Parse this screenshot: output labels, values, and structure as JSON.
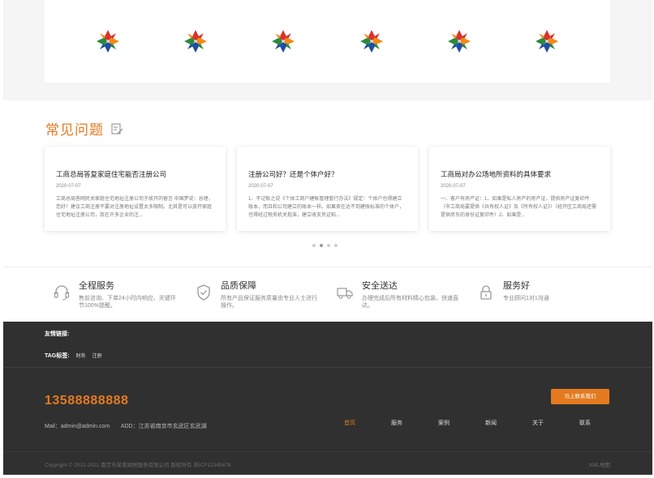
{
  "logos": {
    "count": 6,
    "colors": [
      "#d9342b",
      "#f08a1c",
      "#2b8a3e",
      "#1f4fa0"
    ]
  },
  "faq": {
    "title": "常见问题",
    "icon": "edit-icon",
    "items": [
      {
        "question": "工商总局答复家庭住宅能否注册公司",
        "date": "2020-07-07",
        "excerpt": "工商总局答网民关家庭住宅地址注册公司于故开的留言 中国梦说：总理，您好！建议工商注册不要对注册地址设置太多限制。尤其是可以放开家庭住宅地址注册公司，我在许多企业的注..."
      },
      {
        "question": "注册公司好？还是个体户好？",
        "date": "2020-07-07",
        "excerpt": "1、不记账之说《个体工商户建账管理暂行办法》规定：个体户也得建立账本，而且和公司建立的账本一样。如果卖在达不到建账标准的个体户，也得经过税务机关批准，建立收支凭证粘..."
      },
      {
        "question": "工商局对办公场地所资料的具体要求",
        "date": "2020-07-07",
        "excerpt": "一、客户有房产证：1、如果是私人房产的房产证，提供房产证复印件（市工商局要提供《共有权人证》及《所有权人证》）（经开区工商局还需提供房东的身份证复印件）2、如果是..."
      }
    ]
  },
  "services": [
    {
      "icon": "headset-icon",
      "title": "全程服务",
      "desc": "售前咨询、下单24小时内响应、关键环节100%提醒。"
    },
    {
      "icon": "shield-check-icon",
      "title": "品质保障",
      "desc": "所有产品保证服务质量由专业人士进行操作。"
    },
    {
      "icon": "truck-icon",
      "title": "安全送达",
      "desc": "办理完成后所有材料精心包装、快速直达。"
    },
    {
      "icon": "lock-icon",
      "title": "服务好",
      "desc": "专业顾问1对1沟通"
    }
  ],
  "footer": {
    "links_label": "友情链接:",
    "tags_label": "TAG标签:",
    "tags": [
      "财务",
      "注册"
    ],
    "phone": "13588888888",
    "mail": "Mail：admin@admin.com",
    "address": "ADD：江苏省南京市玄武区玄武湖",
    "contact_button": "马上联系我们",
    "nav": [
      "首页",
      "服务",
      "案例",
      "新闻",
      "关于",
      "联系"
    ],
    "copyright": "Copyright © 2012-2021 南京市某某财税服务有限公司 版权所有  苏ICP12345678",
    "sitemap": "XML地图"
  }
}
